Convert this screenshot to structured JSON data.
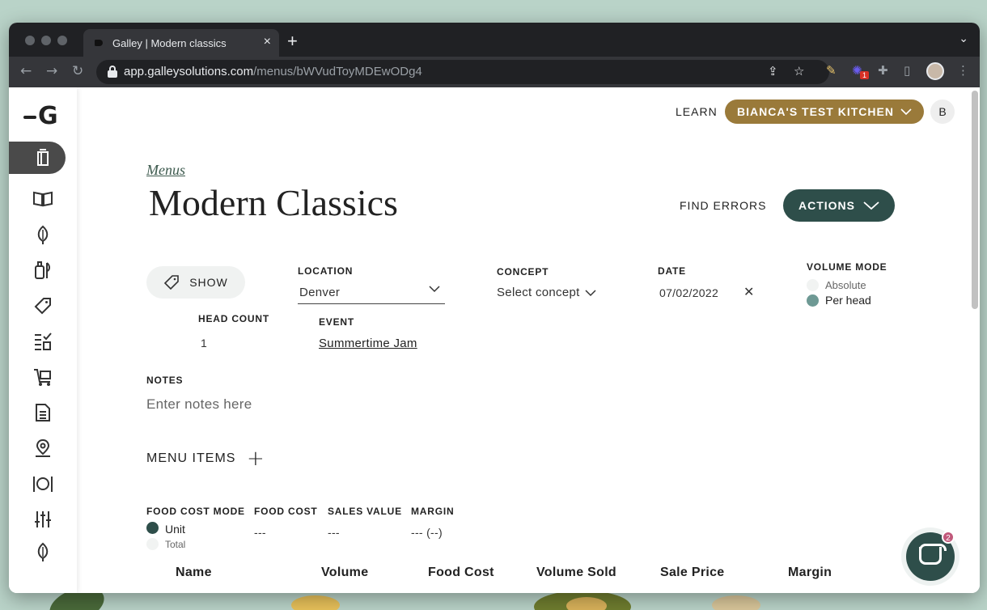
{
  "browser": {
    "tab_title": "Galley | Modern classics",
    "tab_close": "×",
    "new_tab": "+",
    "url_host": "app.galleysolutions.com",
    "url_path": "/menus/bWVudToyMDEwODg4",
    "extension_badge": "1"
  },
  "header": {
    "learn_label": "LEARN",
    "kitchen_label": "BIANCA'S TEST KITCHEN",
    "avatar_initial": "B"
  },
  "sidebar": {
    "logo_letter": "G",
    "items": [
      "menus-icon",
      "recipes-icon",
      "ingredients-icon",
      "preparations-icon",
      "tags-icon",
      "inventory-icon",
      "ordering-icon",
      "reports-icon",
      "locations-icon",
      "dining-icon",
      "settings-icon",
      "onion-icon"
    ]
  },
  "page": {
    "breadcrumb": "Menus",
    "title": "Modern Classics",
    "find_errors": "FIND ERRORS",
    "actions": "ACTIONS",
    "show": "SHOW",
    "location_label": "LOCATION",
    "location_value": "Denver",
    "concept_label": "CONCEPT",
    "concept_value": "Select concept",
    "date_label": "DATE",
    "date_value": "07/02/2022",
    "date_clear": "✕",
    "volume_mode_label": "VOLUME MODE",
    "volume_modes": [
      "Absolute",
      "Per head"
    ],
    "volume_mode_selected": "Per head",
    "head_count_label": "HEAD COUNT",
    "head_count_value": "1",
    "event_label": "EVENT",
    "event_value": "Summertime Jam",
    "notes_label": "NOTES",
    "notes_placeholder": "Enter notes here",
    "menu_items_label": "MENU ITEMS",
    "add_symbol": "+",
    "food_cost_mode_label": "FOOD COST MODE",
    "food_cost_modes": [
      "Unit",
      "Total"
    ],
    "food_cost_mode_selected": "Unit",
    "food_cost_label": "FOOD COST",
    "food_cost_value": "---",
    "sales_value_label": "SALES VALUE",
    "sales_value_value": "---",
    "margin_label": "MARGIN",
    "margin_value": "--- (--)",
    "table_columns": [
      "Name",
      "Volume",
      "Food Cost",
      "Volume Sold",
      "Sale Price",
      "Margin"
    ]
  },
  "chat": {
    "badge": "2"
  },
  "colors": {
    "accent_gold": "#9a7a3a",
    "accent_teal": "#2e4e4a",
    "radio_teal": "#6e9994"
  }
}
